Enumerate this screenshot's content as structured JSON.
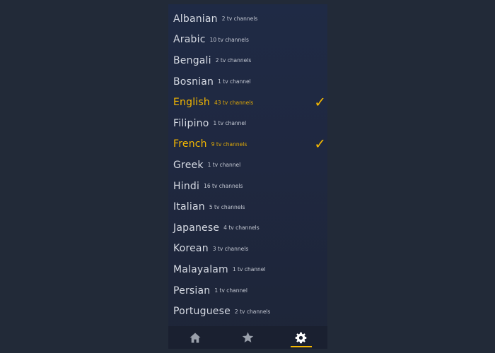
{
  "languages": [
    {
      "name": "Albanian",
      "count": "2 tv channels",
      "selected": false
    },
    {
      "name": "Arabic",
      "count": "10 tv channels",
      "selected": false
    },
    {
      "name": "Bengali",
      "count": "2 tv channels",
      "selected": false
    },
    {
      "name": "Bosnian",
      "count": "1 tv channel",
      "selected": false
    },
    {
      "name": "English",
      "count": "43 tv channels",
      "selected": true
    },
    {
      "name": "Filipino",
      "count": "1 tv channel",
      "selected": false
    },
    {
      "name": "French",
      "count": "9 tv channels",
      "selected": true
    },
    {
      "name": "Greek",
      "count": "1 tv channel",
      "selected": false
    },
    {
      "name": "Hindi",
      "count": "16 tv channels",
      "selected": false
    },
    {
      "name": "Italian",
      "count": "5 tv channels",
      "selected": false
    },
    {
      "name": "Japanese",
      "count": "4 tv channels",
      "selected": false
    },
    {
      "name": "Korean",
      "count": "3 tv channels",
      "selected": false
    },
    {
      "name": "Malayalam",
      "count": "1 tv channel",
      "selected": false
    },
    {
      "name": "Persian",
      "count": "1 tv channel",
      "selected": false
    },
    {
      "name": "Portuguese",
      "count": "2 tv channels",
      "selected": false
    }
  ],
  "nav": {
    "items": [
      {
        "icon": "home-icon",
        "active": false
      },
      {
        "icon": "star-icon",
        "active": false
      },
      {
        "icon": "gear-icon",
        "active": true
      }
    ]
  },
  "colors": {
    "accent": "#f5b800",
    "text": "#d6dae3",
    "icon_inactive": "#9aa0ab",
    "icon_active": "#ffffff"
  }
}
